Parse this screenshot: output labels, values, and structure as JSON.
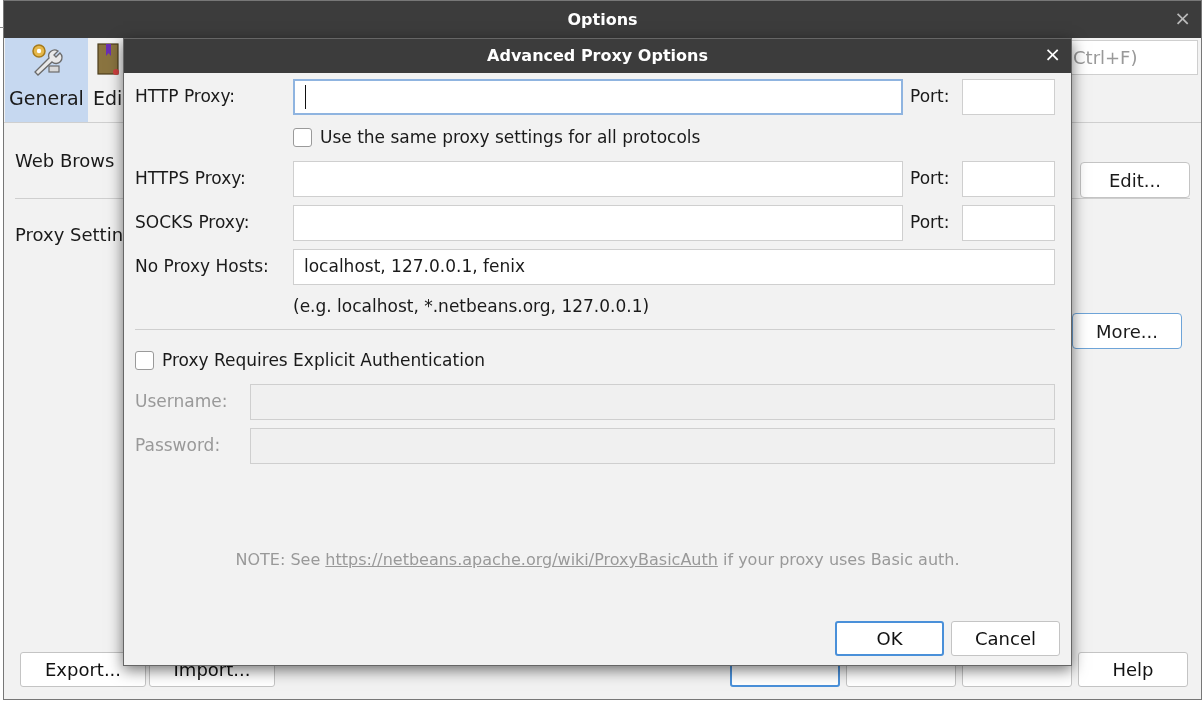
{
  "window": {
    "title": "Options",
    "close": "×"
  },
  "toolbar": {
    "tabs": [
      {
        "label": "General",
        "selected": true,
        "kind": "general"
      },
      {
        "label": "Edi",
        "selected": false,
        "kind": "editor"
      }
    ],
    "search": {
      "placeholder": "Ctrl+F)"
    }
  },
  "content": {
    "rows": [
      {
        "label": "Web Brows",
        "button": "Edit...",
        "focused": false
      },
      {
        "label": "Proxy Settin",
        "button": "More...",
        "focused": true
      }
    ]
  },
  "footer": {
    "left_buttons": [
      "Export...",
      "Import..."
    ],
    "right_buttons": [
      {
        "default": true
      },
      {
        "default": false
      },
      {
        "default": false
      },
      {
        "label": "Help",
        "default": false
      }
    ]
  },
  "dialog": {
    "title": "Advanced Proxy Options",
    "close": "×",
    "proxies": [
      {
        "label": "HTTP Proxy:",
        "focused": true,
        "port_label": "Port:"
      },
      {
        "label": "HTTPS Proxy:",
        "focused": false,
        "port_label": "Port:"
      },
      {
        "label": "SOCKS Proxy:",
        "focused": false,
        "port_label": "Port:"
      }
    ],
    "same_settings": {
      "label": "Use the same proxy settings for all protocols",
      "checked": false
    },
    "no_proxy": {
      "label": "No Proxy Hosts:",
      "value": "localhost, 127.0.0.1, fenix",
      "hint": "(e.g. localhost, *.netbeans.org, 127.0.0.1)"
    },
    "auth": {
      "label": "Proxy Requires Explicit Authentication",
      "checked": false
    },
    "credentials": [
      {
        "label": "Username:",
        "disabled": true
      },
      {
        "label": "Password:",
        "disabled": true
      }
    ],
    "note": {
      "before": "NOTE: See ",
      "link": "https://netbeans.apache.org/wiki/ProxyBasicAuth",
      "after": " if your proxy uses Basic auth."
    },
    "buttons": [
      {
        "label": "OK",
        "default": true
      },
      {
        "label": "Cancel",
        "default": false
      }
    ]
  }
}
